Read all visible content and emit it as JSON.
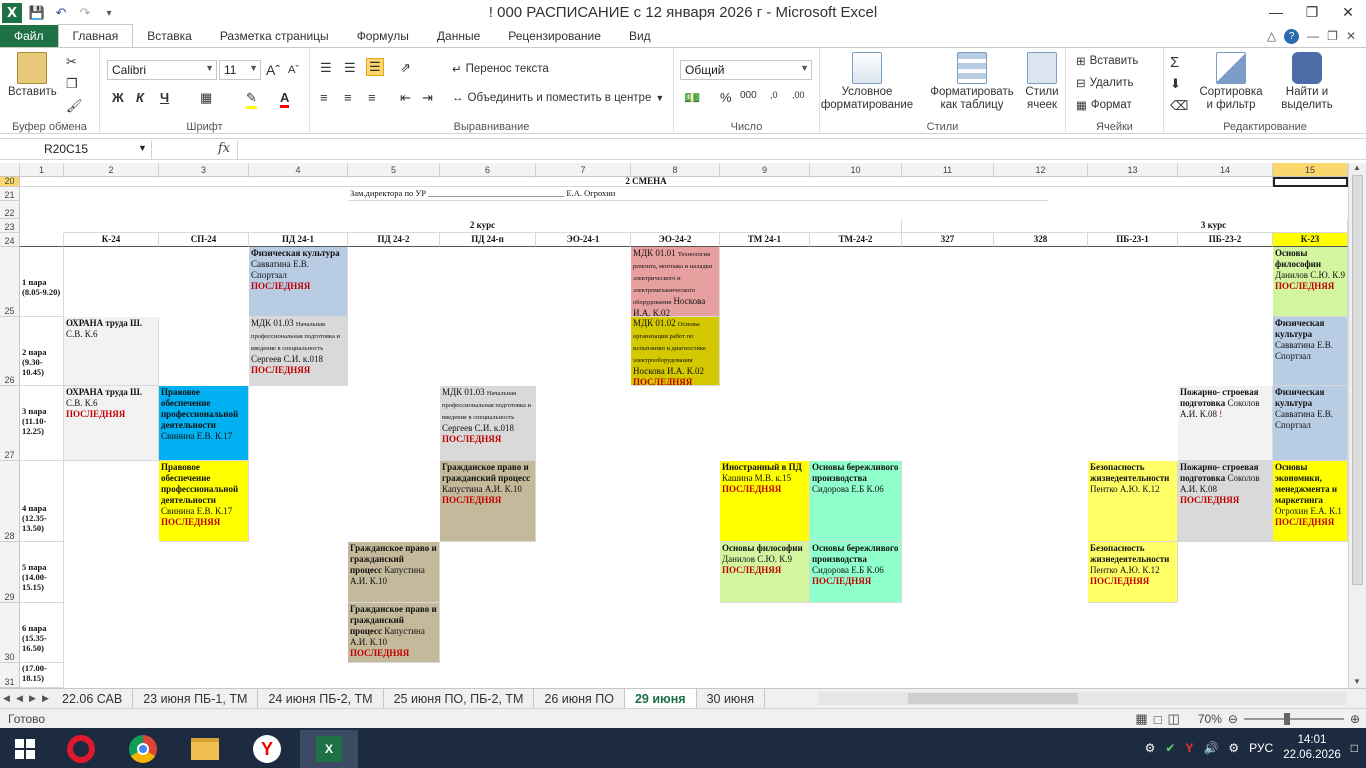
{
  "window": {
    "title": "! 000 РАСПИСАНИЕ с 12 января 2026 г  -  Microsoft Excel"
  },
  "ribbon_tabs": [
    "Файл",
    "Главная",
    "Вставка",
    "Разметка страницы",
    "Формулы",
    "Данные",
    "Рецензирование",
    "Вид"
  ],
  "ribbon": {
    "paste": "Вставить",
    "clipboard": "Буфер обмена",
    "font_name": "Calibri",
    "font_size": "11",
    "font_group": "Шрифт",
    "wrap_text": "Перенос текста",
    "merge_center": "Объединить и поместить в центре",
    "alignment_group": "Выравнивание",
    "number_format": "Общий",
    "number_group": "Число",
    "cond_format": "Условное форматирование",
    "format_table": "Форматировать как таблицу",
    "cell_styles": "Стили ячеек",
    "styles_group": "Стили",
    "insert": "Вставить",
    "delete": "Удалить",
    "format": "Формат",
    "cells_group": "Ячейки",
    "sort_filter": "Сортировка и фильтр",
    "find_select": "Найти и выделить",
    "editing_group": "Редактирование"
  },
  "formula_bar": {
    "name_box": "R20C15",
    "fx": "fx",
    "value": ""
  },
  "columns": [
    "1",
    "2",
    "3",
    "4",
    "5",
    "6",
    "7",
    "8",
    "9",
    "10",
    "11",
    "12",
    "13",
    "14",
    "15"
  ],
  "rows": {
    "r20": "20",
    "r21": "21",
    "r22": "22",
    "r23": "23",
    "r24": "24",
    "r25": "25",
    "r26": "26",
    "r27": "27",
    "r28": "28",
    "r29": "29",
    "r30": "30",
    "r31": "31"
  },
  "sheet": {
    "shift": "2 СМЕНА",
    "deputy": "Зам.директора по УР",
    "deputy_line": "________________________________",
    "deputy_name": "Е.А. Огрохин",
    "course2": "2 курс",
    "course3": "3 курс",
    "groups": [
      "К-24",
      "СП-24",
      "ПД 24-1",
      "ПД 24-2",
      "ПД 24-п",
      "ЭО-24-1",
      "ЭО-24-2",
      "ТМ 24-1",
      "ТМ-24-2",
      "327",
      "328",
      "ПБ-23-1",
      "ПБ-23-2",
      "К-23"
    ],
    "pairs": [
      "1 пара (8.05-9.20)",
      "2 пара (9.30-10.45)",
      "3 пара (11.10-12.25)",
      "4 пара (12.35-13.50)",
      "5 пара (14.00-15.15)",
      "6 пара (15.35-16.50)",
      "(17.00-18.15)"
    ],
    "last": "ПОСЛЕДНЯЯ",
    "c_r25_pd241_a": "Физическая культура",
    "c_r25_pd241_b": "Савватина Е.В. Спортзал",
    "c_r25_eo242_a": "МДК 01.01",
    "c_r25_eo242_b": "Технология ремонта, монтажа и наладки электрического и электромеханического оборудования",
    "c_r25_eo242_c": "Носкова И.А. К.02",
    "c_r25_k23_a": "Основы философии",
    "c_r25_k23_b": "Данилов С.Ю. К.9",
    "c_r26_k24_a": "ОХРАНА труда Ш.",
    "c_r26_k24_b": "С.В. К.6",
    "c_r26_pd241_a": "МДК 01.03",
    "c_r26_pd241_b": "Начальная профессиональная подготовка и введение в специальность",
    "c_r26_pd241_c": "Сергеев С.И. к.018",
    "c_r26_eo242_a": "МДК 01.02",
    "c_r26_eo242_b": "Основы организации работ по испытанию и диагностике электрооборудования",
    "c_r26_eo242_c": "Носкова И.А. К.02",
    "c_r26_k23_a": "Физическая культура",
    "c_r26_k23_b": "Савватина Е.В. Спортзал",
    "c_r27_k24_a": "ОХРАНА труда Ш.",
    "c_r27_k24_b": "С.В. К.6",
    "c_r27_sp24_a": "Правовое обеспечение профессиональной деятельности",
    "c_r27_sp24_b": "Свинина Е.В. К.17",
    "c_r27_pd24p_a": "МДК 01.03",
    "c_r27_pd24p_b": "Начальная профессиональная подготовка и введение в специальность",
    "c_r27_pd24p_c": "Сергеев С.И. к.018",
    "c_r27_pb232_a": "Пожарно- строевая подготовка",
    "c_r27_pb232_b": "Соколов А.И. К.08",
    "c_r27_pb232_c": "!",
    "c_r27_k23_a": "Физическая культура",
    "c_r27_k23_b": "Савватина Е.В. Спортзал",
    "c_r28_sp24_a": "Правовое обеспечение профессиональной деятельности",
    "c_r28_sp24_b": "Свинина Е.В. К.17",
    "c_r28_pd24p_a": "Гражданское право и гражданский процесс",
    "c_r28_pd24p_b": "Капустина А.И. К.10",
    "c_r28_tm241_a": "Иностранный в ПД",
    "c_r28_tm241_b": "Кашина М.В. к.15",
    "c_r28_tm242_a": "Основы бережливого производства",
    "c_r28_tm242_b": "Сидорова Е.Б К.06",
    "c_r28_pb231_a": "Безопасность жизнедеятельности",
    "c_r28_pb231_b": "Пентко А.Ю. К.12",
    "c_r28_pb232_a": "Пожарно- строевая подготовка",
    "c_r28_pb232_b": "Соколов А.И. К.08",
    "c_r28_k23_a": "Основы экономики, менеджмента и маркетинга",
    "c_r28_k23_b": "Огрохин Е.А. К.1",
    "c_r29_pd242_a": "Гражданское право и гражданский процесс",
    "c_r29_pd242_b": "Капустина А.И. К.10",
    "c_r29_tm241_a": "Основы философии",
    "c_r29_tm241_b": "Данилов С.Ю. К.9",
    "c_r29_tm242_a": "Основы бережливого производства",
    "c_r29_tm242_b": "Сидорова Е.Б К.06",
    "c_r29_pb231_a": "Безопасность жизнедеятельности",
    "c_r29_pb231_b": "Пентко А.Ю. К.12",
    "c_r30_pd242_a": "Гражданское право и гражданский процесс",
    "c_r30_pd242_b": "Капустина А.И. К.10"
  },
  "sheet_tabs": [
    "22.06 САВ",
    "23 июня ПБ-1, ТМ",
    "24 июня ПБ-2, ТМ",
    "25 июня ПО, ПБ-2, ТМ",
    "26 июня ПО",
    "29 июня",
    "30 июня"
  ],
  "status": {
    "ready": "Готово",
    "zoom": "70%"
  },
  "taskbar": {
    "lang": "РУС",
    "time": "14:01",
    "date": "22.06.2026"
  },
  "colors": {
    "excel_green": "#1e7145",
    "blue_cell": "#b8cce4",
    "gray_cell": "#d9d9d9",
    "pink_cell": "#e6a0a0",
    "olive_cell": "#d4c800",
    "cyan_cell": "#00b0f0",
    "yellow_cell": "#ffff00",
    "tan_cell": "#c4b99a",
    "green_cell": "#d4f5a0",
    "mint_cell": "#8fffcc",
    "light_yellow": "#ffff66",
    "last_red": "#c00000"
  }
}
